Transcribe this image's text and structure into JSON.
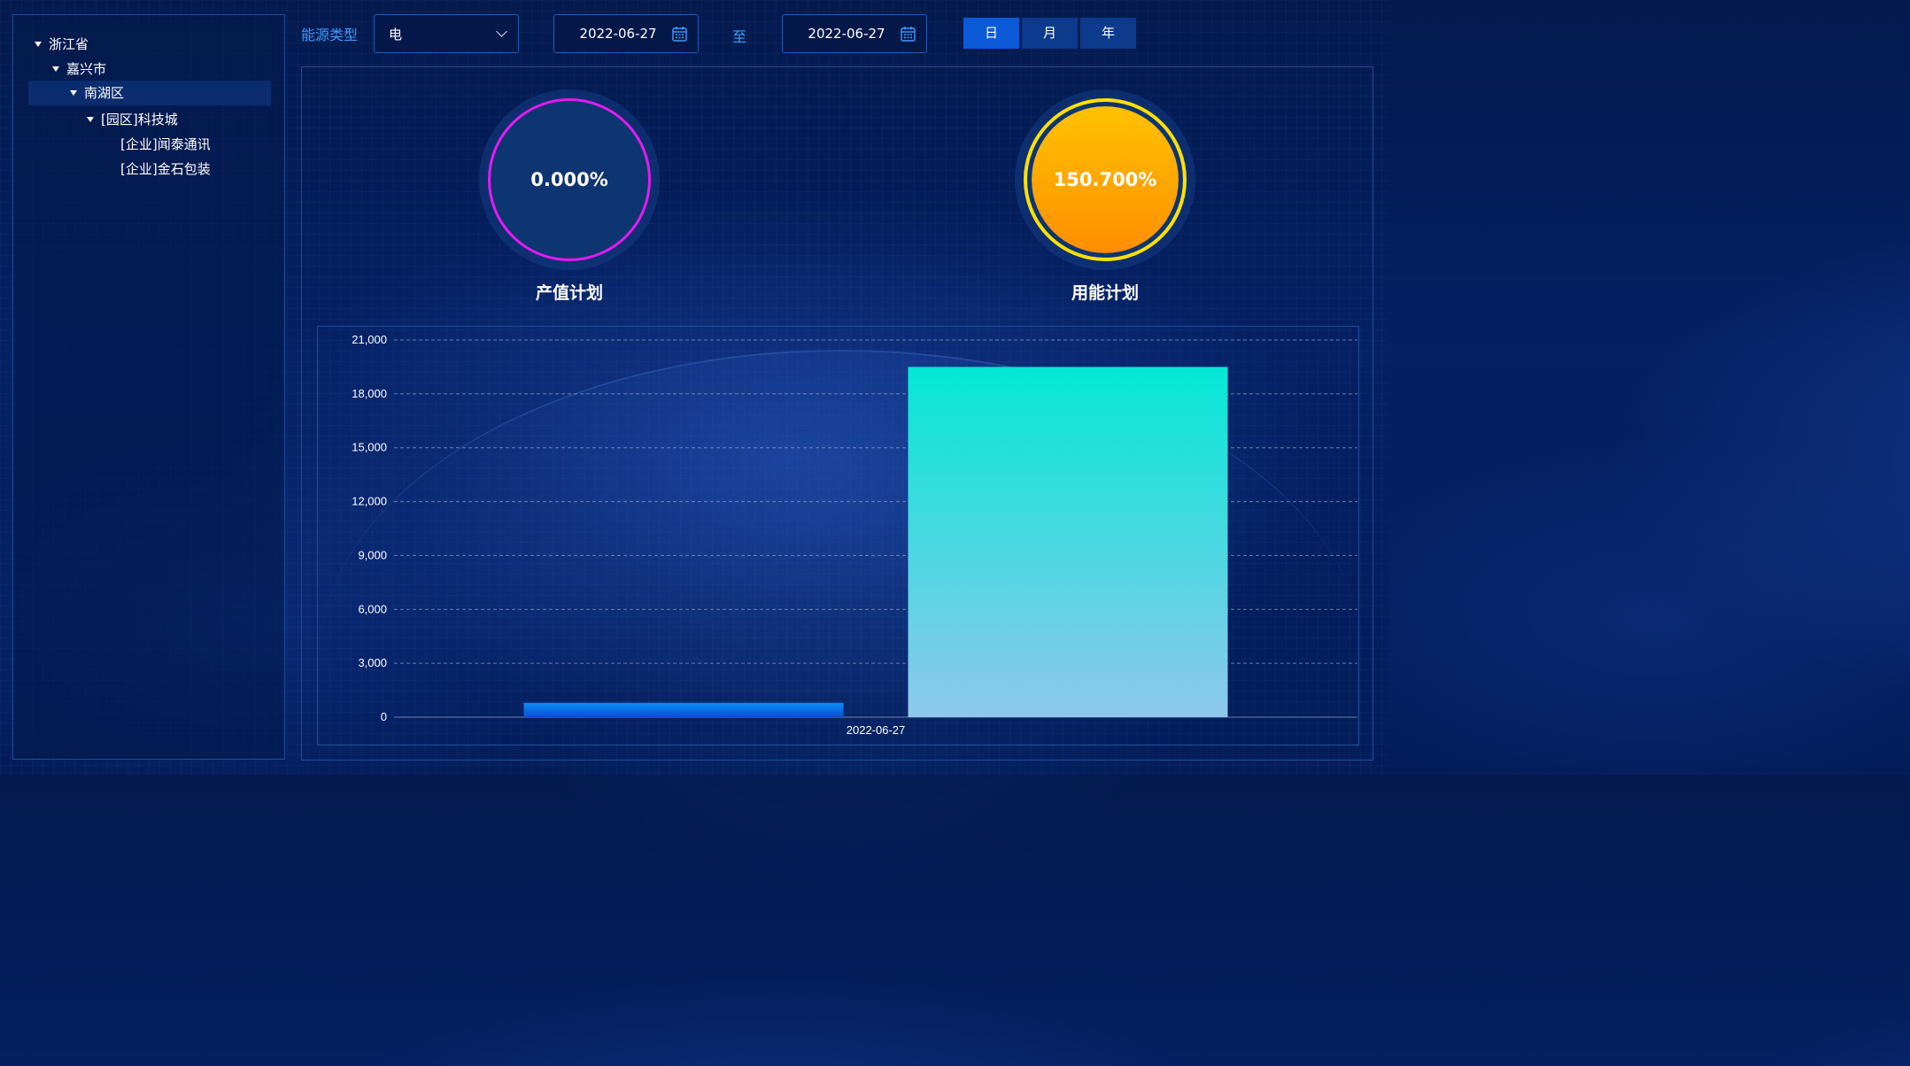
{
  "tree": {
    "nodes": [
      {
        "label": "浙江省",
        "expanded": true,
        "selected": false
      },
      {
        "label": "嘉兴市",
        "expanded": true,
        "selected": false
      },
      {
        "label": "南湖区",
        "expanded": true,
        "selected": true
      },
      {
        "label": "[园区]科技城",
        "expanded": true,
        "selected": false
      },
      {
        "label": "[企业]闻泰通讯",
        "expanded": false,
        "selected": false
      },
      {
        "label": "[企业]金石包装",
        "expanded": false,
        "selected": false
      }
    ]
  },
  "toolbar": {
    "energy_type_label": "能源类型",
    "energy_type_value": "电",
    "start_date": "2022-06-27",
    "to_label": "至",
    "end_date": "2022-06-27",
    "periods": [
      "日",
      "月",
      "年"
    ],
    "active_period": "日"
  },
  "gauges": [
    {
      "value": "0.000%",
      "label": "产值计划",
      "ring_color": "#e21bf0",
      "fill": "#0d3571"
    },
    {
      "value": "150.700%",
      "label": "用能计划",
      "ring_color": "#ffe100",
      "fill": "#ff9c00"
    }
  ],
  "chart_data": {
    "type": "bar",
    "categories": [
      "2022-06-27"
    ],
    "series": [
      {
        "values": [
          800
        ],
        "color": "#0a7cf0"
      },
      {
        "values": [
          19500
        ],
        "color": "#04e8d6"
      }
    ],
    "ylim": [
      0,
      21000
    ],
    "yticks": [
      "0",
      "3,000",
      "6,000",
      "9,000",
      "12,000",
      "15,000",
      "18,000",
      "21,000"
    ],
    "grid": true,
    "title": "",
    "xlabel": "",
    "ylabel": ""
  }
}
